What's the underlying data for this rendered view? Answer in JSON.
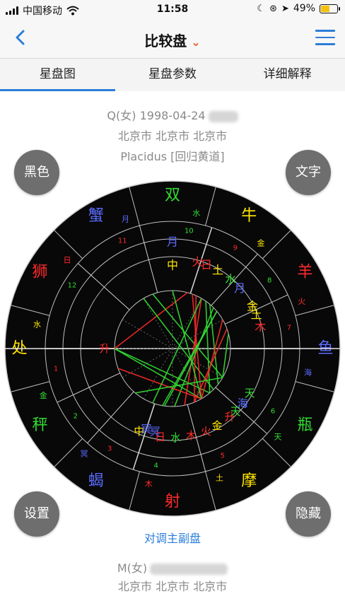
{
  "status": {
    "carrier": "中国移动",
    "time": "11:58",
    "battery": "49%"
  },
  "nav": {
    "back_icon": "chevron-left-icon",
    "title": "比较盘",
    "title_chevron": "chevron-down-icon",
    "menu_icon": "hamburger-menu-icon",
    "accent_color": "#2a7ed8"
  },
  "tabs": [
    {
      "label": "星盘图",
      "active": true
    },
    {
      "label": "星盘参数",
      "active": false
    },
    {
      "label": "详细解释",
      "active": false
    }
  ],
  "chart_info_top": {
    "name_date": "Q(女) 1998-04-24",
    "location": "北京市 北京市 北京市",
    "system": "Placidus [回归黄道]"
  },
  "buttons": {
    "black": "黑色",
    "text": "文字",
    "settings": "设置",
    "hide": "隐藏"
  },
  "swap_link": "对调主副盘",
  "chart_info_bottom": {
    "name": "M(女)",
    "location": "北京市 北京市 北京市"
  },
  "wheel": {
    "signs": [
      "羊",
      "牛",
      "双",
      "蟹",
      "狮",
      "处",
      "秤",
      "蝎",
      "射",
      "摩",
      "瓶",
      "鱼"
    ],
    "rulers": [
      "火",
      "金",
      "水",
      "月",
      "日",
      "水",
      "金",
      "冥",
      "木",
      "土",
      "天",
      "海"
    ],
    "sign_colors": [
      "#ff2a2a",
      "#ffe600",
      "#33dd33",
      "#5b6bff",
      "#ff2a2a",
      "#ffe600",
      "#33dd33",
      "#5b6bff",
      "#ff2a2a",
      "#ffe600",
      "#33dd33",
      "#5b6bff"
    ],
    "house_numbers": [
      "1",
      "2",
      "3",
      "4",
      "5",
      "6",
      "7",
      "8",
      "9",
      "10",
      "11",
      "12"
    ],
    "outer_planets": [
      {
        "g": "中",
        "c": "#ffe600"
      },
      {
        "g": "月",
        "c": "#5b6bff"
      },
      {
        "g": "火",
        "c": "#ff2a2a"
      },
      {
        "g": "日",
        "c": "#ff2a2a"
      },
      {
        "g": "土",
        "c": "#ffe600"
      },
      {
        "g": "水",
        "c": "#33dd33"
      },
      {
        "g": "月",
        "c": "#5b6bff"
      },
      {
        "g": "金",
        "c": "#ffe600"
      },
      {
        "g": "土",
        "c": "#ffe600"
      },
      {
        "g": "木",
        "c": "#ff2a2a"
      }
    ],
    "inner_planets": [
      {
        "g": "天",
        "c": "#33dd33"
      },
      {
        "g": "海",
        "c": "#5b6bff"
      },
      {
        "g": "天",
        "c": "#33dd33"
      },
      {
        "g": "海",
        "c": "#5b6bff"
      },
      {
        "g": "升",
        "c": "#ff2a2a"
      },
      {
        "g": "金",
        "c": "#ffe600"
      },
      {
        "g": "火",
        "c": "#ff2a2a"
      },
      {
        "g": "木",
        "c": "#ff2a2a"
      },
      {
        "g": "水",
        "c": "#33dd33"
      },
      {
        "g": "日",
        "c": "#ff2a2a"
      },
      {
        "g": "冥",
        "c": "#5b6bff"
      },
      {
        "g": "中",
        "c": "#ffe600"
      },
      {
        "g": "冥",
        "c": "#5b6bff"
      }
    ],
    "ascendant": {
      "g": "升",
      "c": "#ff2a2a"
    }
  }
}
